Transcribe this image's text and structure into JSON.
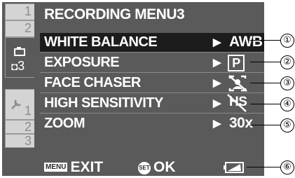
{
  "menu": {
    "title": "RECORDING MENU3",
    "tabs_top": [
      "1",
      "2"
    ],
    "tab_selected": "3",
    "tabs_bottom": [
      "1",
      "2",
      "3"
    ],
    "items": [
      {
        "label": "WHITE BALANCE",
        "value": "AWB"
      },
      {
        "label": "EXPOSURE",
        "value": "P"
      },
      {
        "label": "FACE CHASER",
        "value": ""
      },
      {
        "label": "HIGH SENSITIVITY",
        "value": "HS"
      },
      {
        "label": "ZOOM",
        "value": "30x"
      }
    ],
    "arrow": "▶"
  },
  "footer": {
    "menu_badge": "MENU",
    "exit_label": "EXIT",
    "set_badge": "SET",
    "ok_label": "OK"
  },
  "callouts": [
    "①",
    "②",
    "③",
    "④",
    "⑤",
    "⑥"
  ],
  "icons": [
    "camera-icon",
    "wrench-icon",
    "face-crossed-icon",
    "hs-crossed-icon",
    "battery-icon"
  ],
  "colors": {
    "screen_bg": "#5a5a5a",
    "selected_row": "#1c1c1c",
    "tab_bg": "#d4d4d4"
  }
}
